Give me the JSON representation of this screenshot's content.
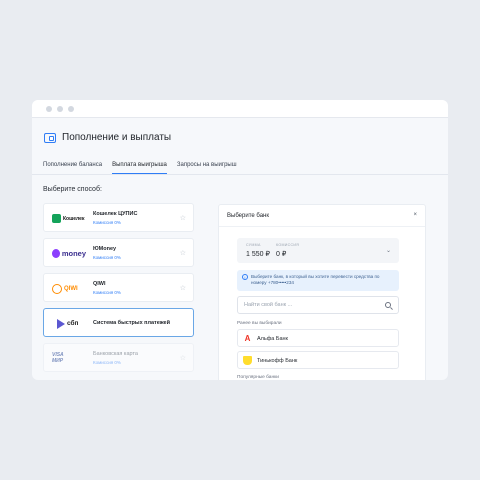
{
  "header": {
    "title": "Пополнение и выплаты"
  },
  "tabs": [
    {
      "label": "Пополнение баланса",
      "active": false
    },
    {
      "label": "Выплата выигрыша",
      "active": true
    },
    {
      "label": "Запросы на выигрыш",
      "active": false
    }
  ],
  "choose_label": "Выберите способ:",
  "methods": [
    {
      "logo_text": "Кошелек",
      "name": "Кошелек ЦУПИС",
      "fee": "Комиссия 0%",
      "state": "normal"
    },
    {
      "logo_text": "money",
      "name": "ЮMoney",
      "fee": "Комиссия 0%",
      "state": "normal"
    },
    {
      "logo_text": "QIWI",
      "name": "QIWI",
      "fee": "Комиссия 0%",
      "state": "normal"
    },
    {
      "logo_text": "сбп",
      "name": "Система быстрых платежей",
      "fee": "",
      "state": "selected"
    },
    {
      "logo_text_1": "VISA",
      "logo_text_2": "МИР",
      "name": "Банковская карта",
      "fee": "Комиссия 0%",
      "state": "disabled"
    }
  ],
  "bank_panel": {
    "title": "Выберите банк",
    "close": "×",
    "sum_caption": "СУММА",
    "sum_value": "1 550 ₽",
    "fee_caption": "КОМИССИЯ",
    "fee_value": "0 ₽",
    "info_text": "Выберите банк, в который вы хотите перевести средства по номеру +780•••••234",
    "search_placeholder": "Найти свой банк ...",
    "recent_label": "Ранее вы выбирали",
    "recent_banks": [
      {
        "logo": "А",
        "name": "Альфа Банк"
      },
      {
        "logo": "",
        "name": "Тинькофф Банк"
      }
    ],
    "popular_label": "Популярные банки"
  },
  "colors": {
    "accent": "#2f7df6",
    "background": "#e9ecf1",
    "selected_border": "#6aa7e6"
  }
}
